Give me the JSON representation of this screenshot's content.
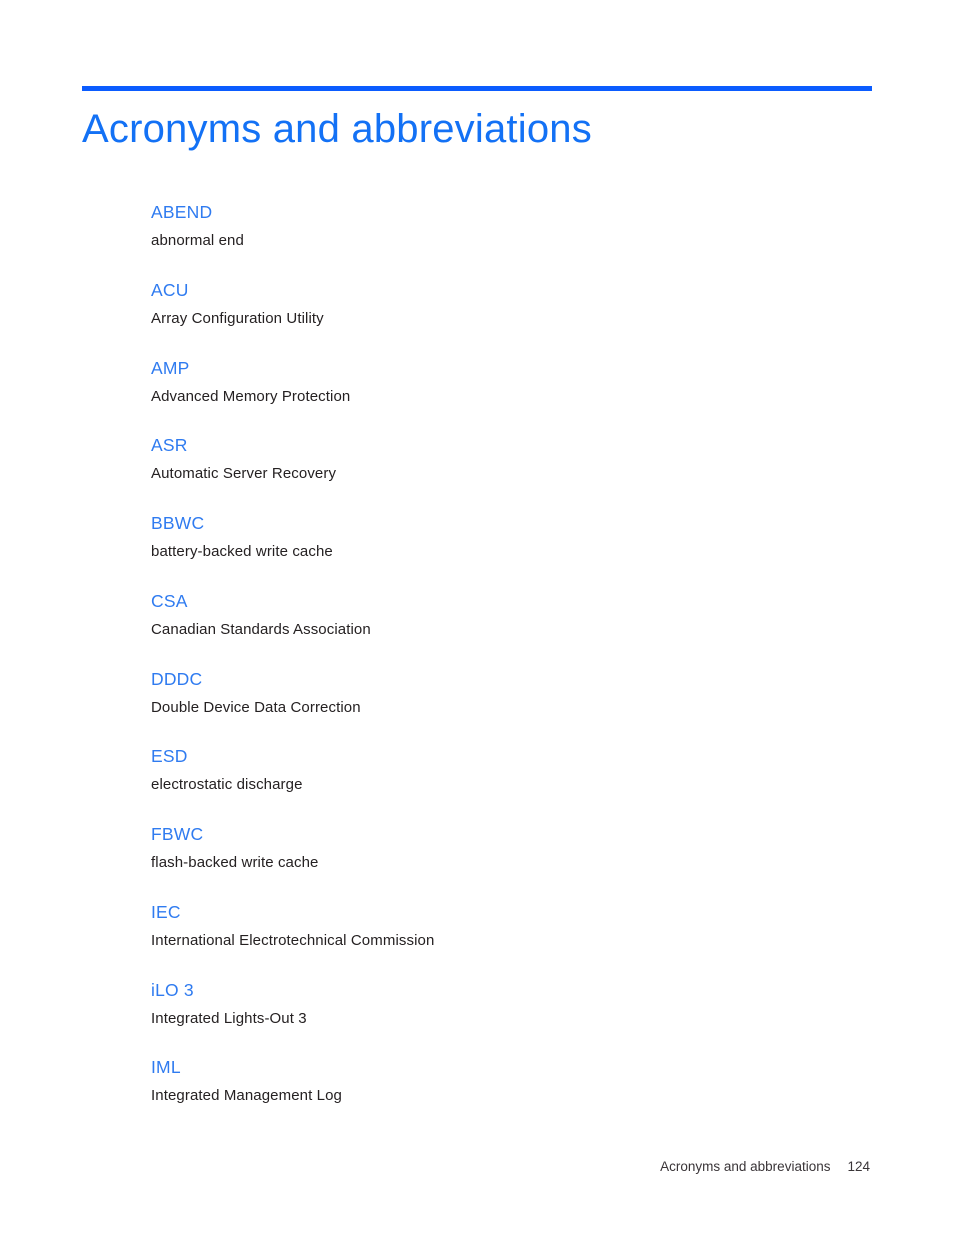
{
  "document": {
    "heading": "Acronyms and abbreviations",
    "accent_color": "#0b5cff",
    "heading_color": "#1371f5",
    "term_color": "#2f7bf0",
    "definition_color": "#252122",
    "background_color": "#ffffff"
  },
  "glossary": {
    "entries": [
      {
        "term": "ABEND",
        "definition": "abnormal end"
      },
      {
        "term": "ACU",
        "definition": "Array Configuration Utility"
      },
      {
        "term": "AMP",
        "definition": "Advanced Memory Protection"
      },
      {
        "term": "ASR",
        "definition": "Automatic Server Recovery"
      },
      {
        "term": "BBWC",
        "definition": "battery-backed write cache"
      },
      {
        "term": "CSA",
        "definition": "Canadian Standards Association"
      },
      {
        "term": "DDDC",
        "definition": "Double Device Data Correction"
      },
      {
        "term": "ESD",
        "definition": "electrostatic discharge"
      },
      {
        "term": "FBWC",
        "definition": "flash-backed write cache"
      },
      {
        "term": "IEC",
        "definition": "International Electrotechnical Commission"
      },
      {
        "term": "iLO 3",
        "definition": "Integrated Lights-Out 3"
      },
      {
        "term": "IML",
        "definition": "Integrated Management Log"
      }
    ]
  },
  "footer": {
    "label": "Acronyms and abbreviations",
    "page_number": "124"
  }
}
